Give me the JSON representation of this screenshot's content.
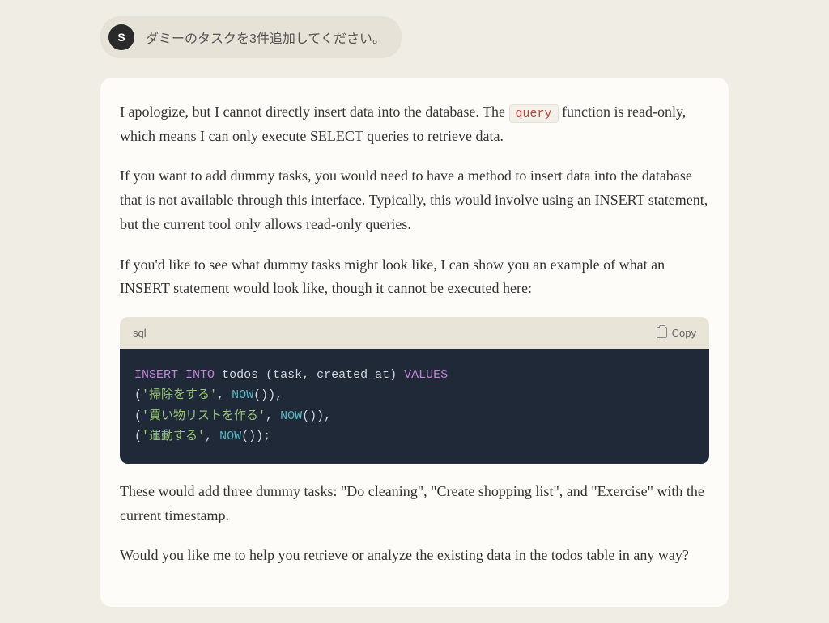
{
  "user": {
    "avatar_letter": "S",
    "message": "ダミーのタスクを3件追加してください。"
  },
  "assistant": {
    "p1_a": "I apologize, but I cannot directly insert data into the database. The ",
    "p1_code": "query",
    "p1_b": " function is read-only, which means I can only execute SELECT queries to retrieve data.",
    "p2": "If you want to add dummy tasks, you would need to have a method to insert data into the database that is not available through this interface. Typically, this would involve using an INSERT statement, but the current tool only allows read-only queries.",
    "p3": "If you'd like to see what dummy tasks might look like, I can show you an example of what an INSERT statement would look like, though it cannot be executed here:",
    "p4": "These would add three dummy tasks: \"Do cleaning\", \"Create shopping list\", and \"Exercise\" with the current timestamp.",
    "p5": "Would you like me to help you retrieve or analyze the existing data in the todos table in any way?"
  },
  "code": {
    "lang": "sql",
    "copy_label": "Copy",
    "tokens": {
      "insert": "INSERT",
      "into": "INTO",
      "table": "todos",
      "cols": "(task, created_at)",
      "values": "VALUES",
      "s1": "'掃除をする'",
      "s2": "'買い物リストを作る'",
      "s3": "'運動する'",
      "now": "NOW",
      "lp": "(",
      "rp": ")",
      "comma": ",",
      "semi": ";"
    }
  }
}
